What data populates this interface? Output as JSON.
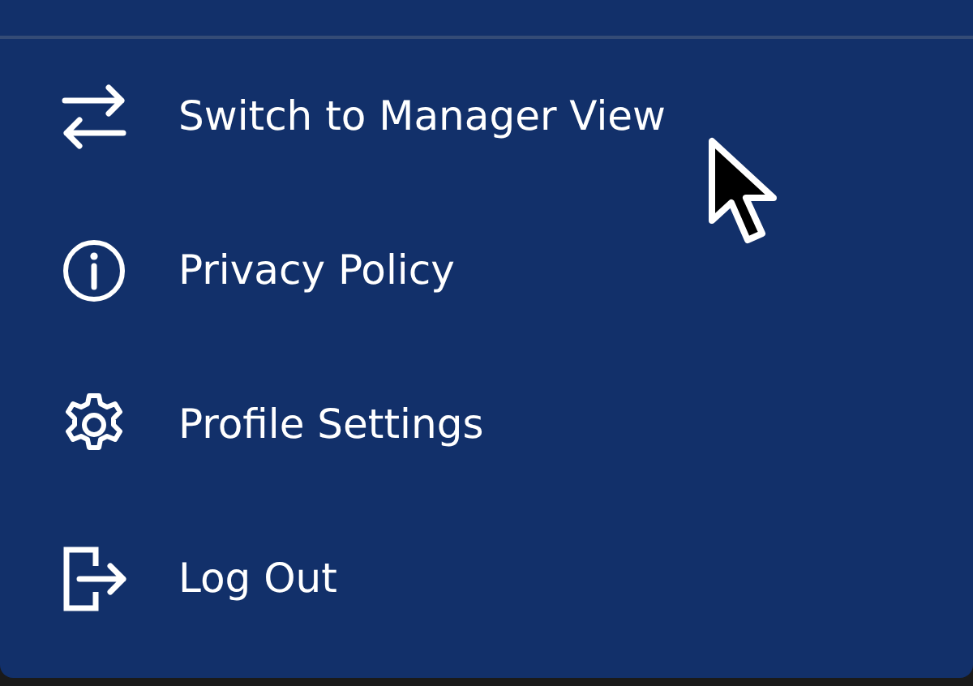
{
  "menu": {
    "items": [
      {
        "kind": "switch",
        "label": "Switch to Manager View"
      },
      {
        "kind": "info",
        "label": "Privacy Policy"
      },
      {
        "kind": "settings",
        "label": "Profile Settings"
      },
      {
        "kind": "logout",
        "label": "Log Out"
      }
    ]
  }
}
